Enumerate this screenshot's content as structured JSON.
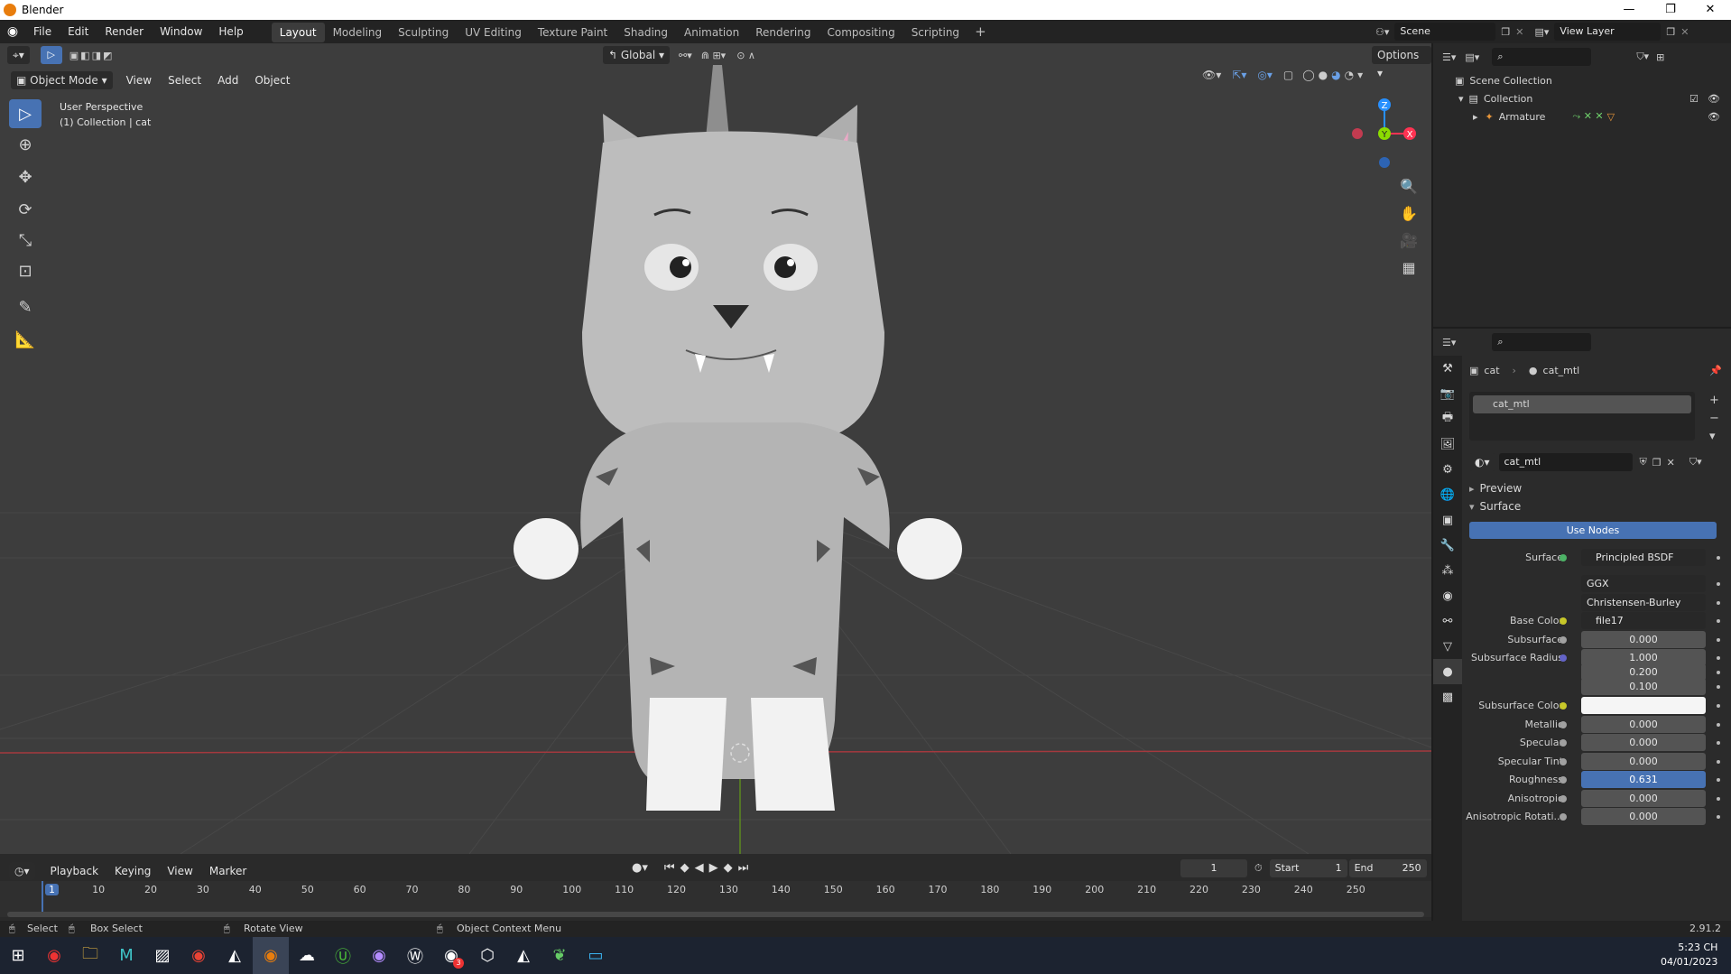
{
  "app": {
    "title": "Blender"
  },
  "menus": [
    "File",
    "Edit",
    "Render",
    "Window",
    "Help"
  ],
  "workspaces": [
    "Layout",
    "Modeling",
    "Sculpting",
    "UV Editing",
    "Texture Paint",
    "Shading",
    "Animation",
    "Rendering",
    "Compositing",
    "Scripting"
  ],
  "active_workspace": "Layout",
  "scene": {
    "name": "Scene",
    "view_layer": "View Layer"
  },
  "viewport": {
    "mode": "Object Mode",
    "menus": [
      "View",
      "Select",
      "Add",
      "Object"
    ],
    "transform_orientation": "Global",
    "options_label": "Options",
    "info_line1": "User Perspective",
    "info_line2": "(1) Collection | cat",
    "axis_x": "X",
    "axis_y": "Y",
    "axis_z": "Z"
  },
  "outliner": {
    "items": [
      {
        "label": "Scene Collection",
        "icon": "scene-collection-icon"
      },
      {
        "label": "Collection",
        "icon": "collection-icon"
      },
      {
        "label": "Armature",
        "icon": "armature-icon"
      }
    ]
  },
  "properties": {
    "breadcrumb_object": "cat",
    "breadcrumb_material": "cat_mtl",
    "slot": "cat_mtl",
    "material_name": "cat_mtl",
    "panel_preview": "Preview",
    "panel_surface": "Surface",
    "use_nodes": "Use Nodes",
    "fields": [
      {
        "label": "Surface",
        "value": "Principled BSDF"
      },
      {
        "label": "",
        "value": "GGX"
      },
      {
        "label": "",
        "value": "Christensen-Burley"
      },
      {
        "label": "Base Color",
        "value": "file17"
      },
      {
        "label": "Subsurface",
        "value": "0.000"
      },
      {
        "label": "Subsurface Radius",
        "value": "1.000"
      },
      {
        "label": "",
        "value": "0.200"
      },
      {
        "label": "",
        "value": "0.100"
      },
      {
        "label": "Subsurface Color",
        "value": ""
      },
      {
        "label": "Metallic",
        "value": "0.000"
      },
      {
        "label": "Specular",
        "value": "0.000"
      },
      {
        "label": "Specular Tint",
        "value": "0.000"
      },
      {
        "label": "Roughness",
        "value": "0.631"
      },
      {
        "label": "Anisotropic",
        "value": "0.000"
      },
      {
        "label": "Anisotropic Rotati...",
        "value": "0.000"
      }
    ]
  },
  "timeline": {
    "menus": [
      "Playback",
      "Keying",
      "View",
      "Marker"
    ],
    "current_frame": "1",
    "start_label": "Start",
    "start": "1",
    "end_label": "End",
    "end": "250",
    "ticks": [
      "1",
      "10",
      "20",
      "30",
      "40",
      "50",
      "60",
      "70",
      "80",
      "90",
      "100",
      "110",
      "120",
      "130",
      "140",
      "150",
      "160",
      "170",
      "180",
      "190",
      "200",
      "210",
      "220",
      "230",
      "240",
      "250"
    ]
  },
  "statusbar": {
    "select": "Select",
    "box_select": "Box Select",
    "rotate_view": "Rotate View",
    "context_menu": "Object Context Menu",
    "version": "2.91.2"
  },
  "taskbar": {
    "time": "5:23 CH",
    "date": "04/01/2023",
    "badge": "3"
  },
  "colors": {
    "accent": "#4772b3",
    "viewport_bg": "#3d3d3d",
    "x_axis": "#ff3352",
    "y_axis": "#8bdc00",
    "z_axis": "#2890ff"
  }
}
